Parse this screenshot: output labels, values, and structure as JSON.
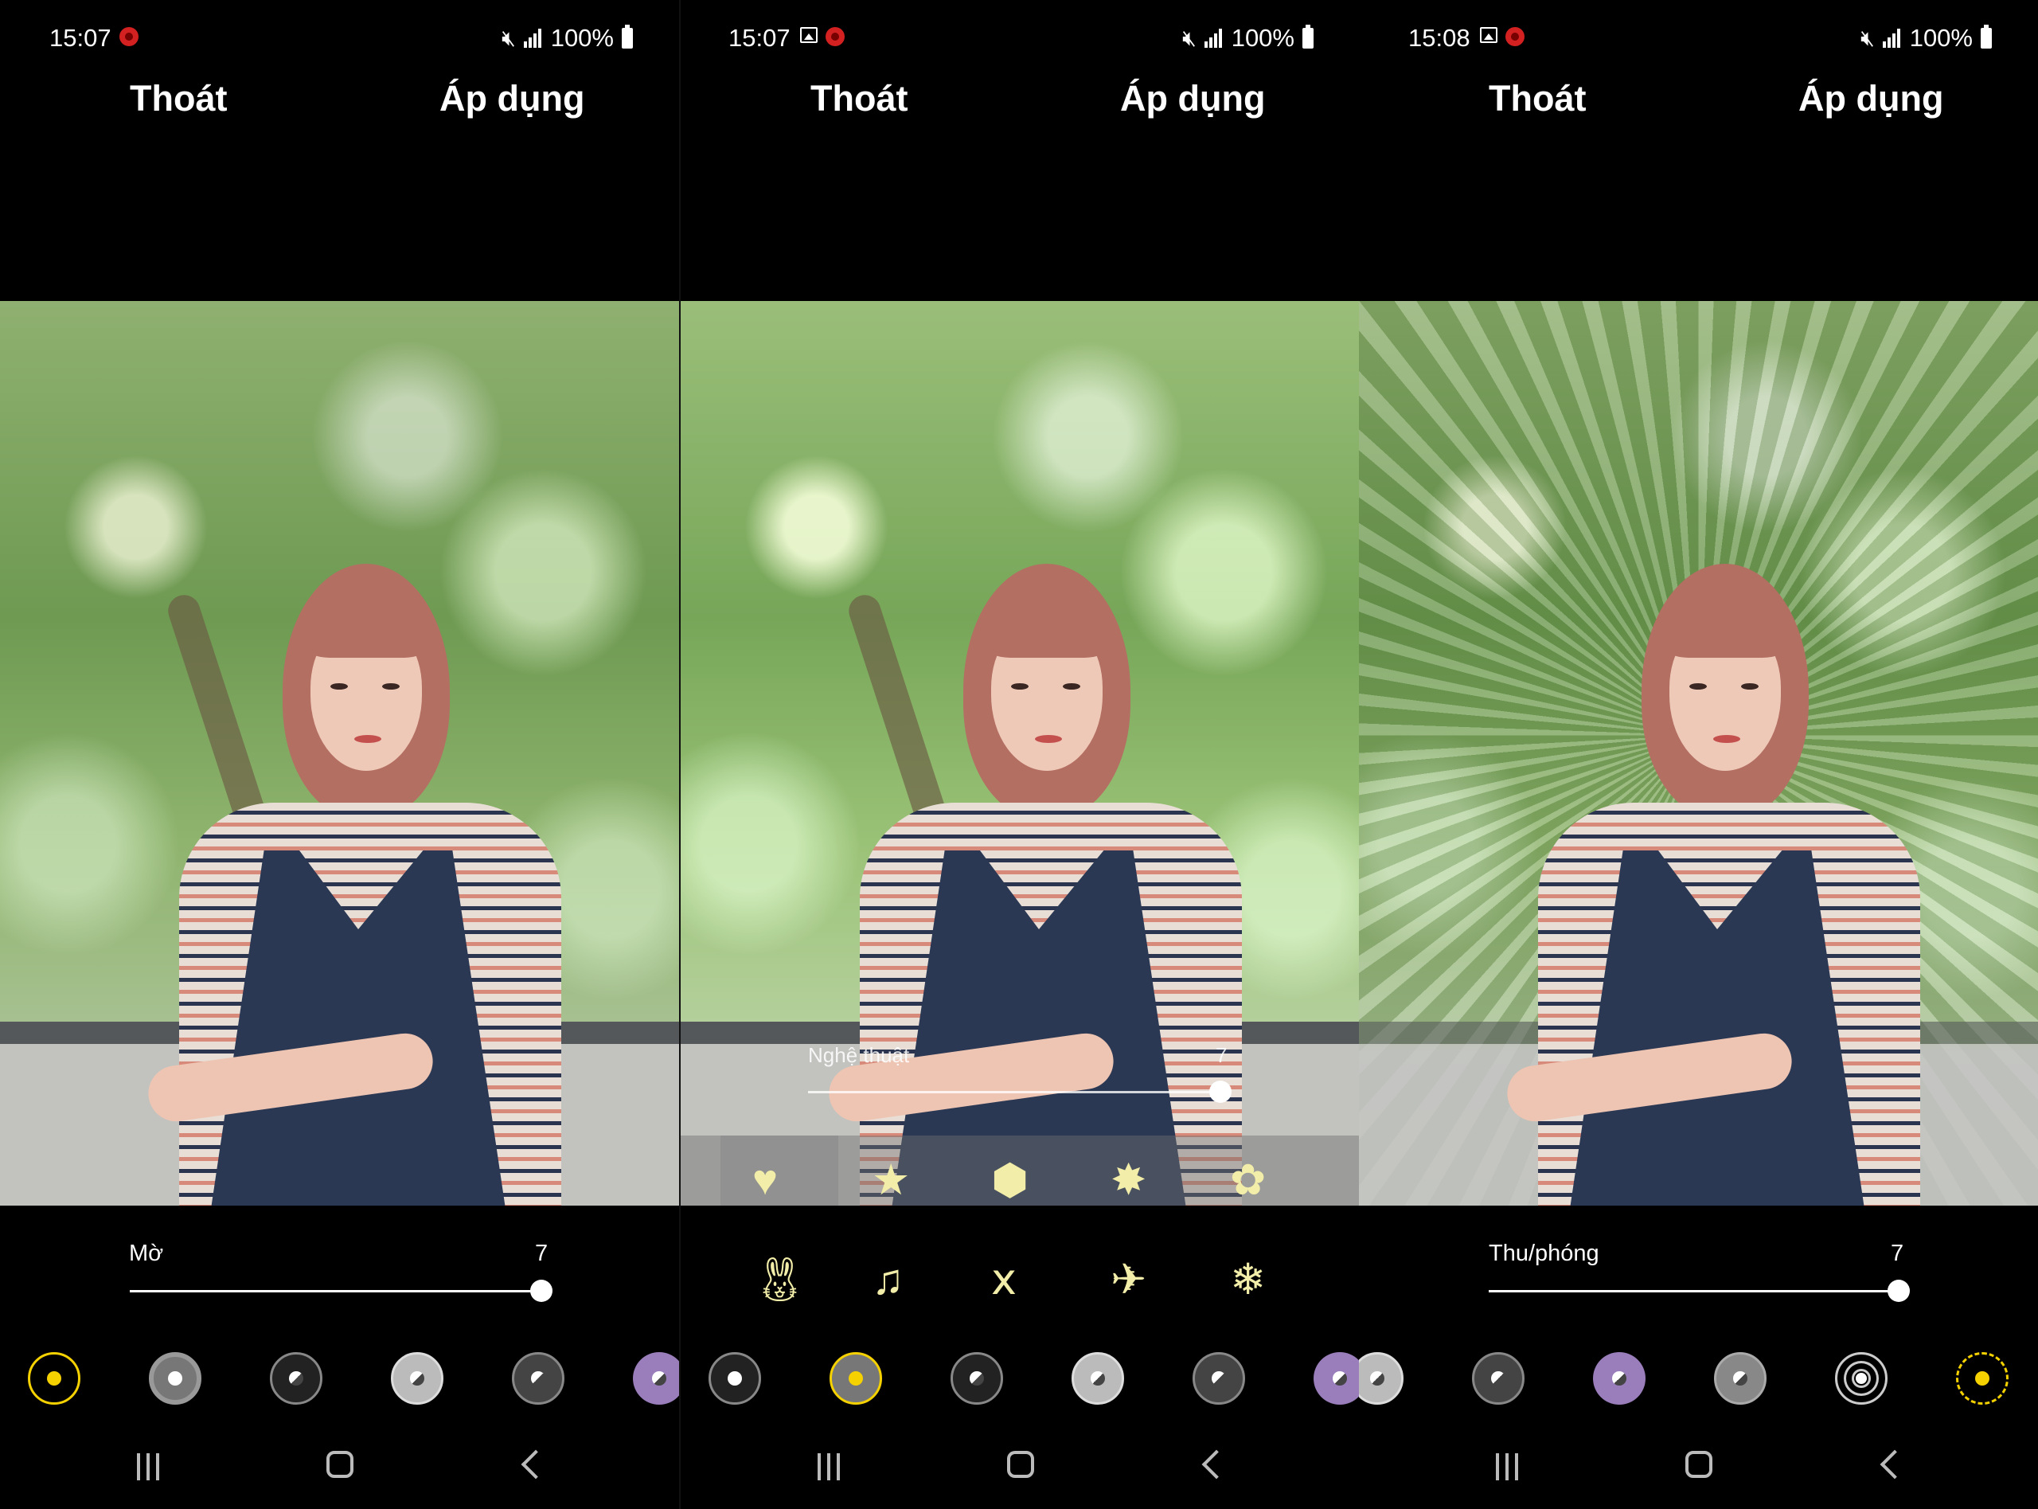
{
  "panels": [
    {
      "status": {
        "time": "15:07",
        "battery": "100%"
      },
      "header": {
        "exit_label": "Thoát",
        "apply_label": "Áp dụng"
      },
      "slider": {
        "label": "Mờ",
        "value": "7",
        "level": 1.0
      },
      "effects_selected_index": 0
    },
    {
      "status": {
        "time": "15:07",
        "battery": "100%"
      },
      "header": {
        "exit_label": "Thoát",
        "apply_label": "Áp dụng"
      },
      "slider": {
        "label": "Nghệ thuật",
        "value": "7",
        "level": 1.0
      },
      "shapes": [
        "heart",
        "star",
        "hexagon",
        "sparkle",
        "flower"
      ],
      "shapes_row2": [
        "rabbit",
        "music-note",
        "butterfly",
        "airplane",
        "snowflake"
      ],
      "effects_selected_index": 1
    },
    {
      "status": {
        "time": "15:08",
        "battery": "100%"
      },
      "header": {
        "exit_label": "Thoát",
        "apply_label": "Áp dụng"
      },
      "slider": {
        "label": "Thu/phóng",
        "value": "7",
        "level": 1.0
      },
      "effects_selected_index": 5
    }
  ],
  "colors": {
    "accent_yellow": "#f5d100",
    "purple": "#9a7dbb",
    "gray": "#8a8a8a"
  }
}
